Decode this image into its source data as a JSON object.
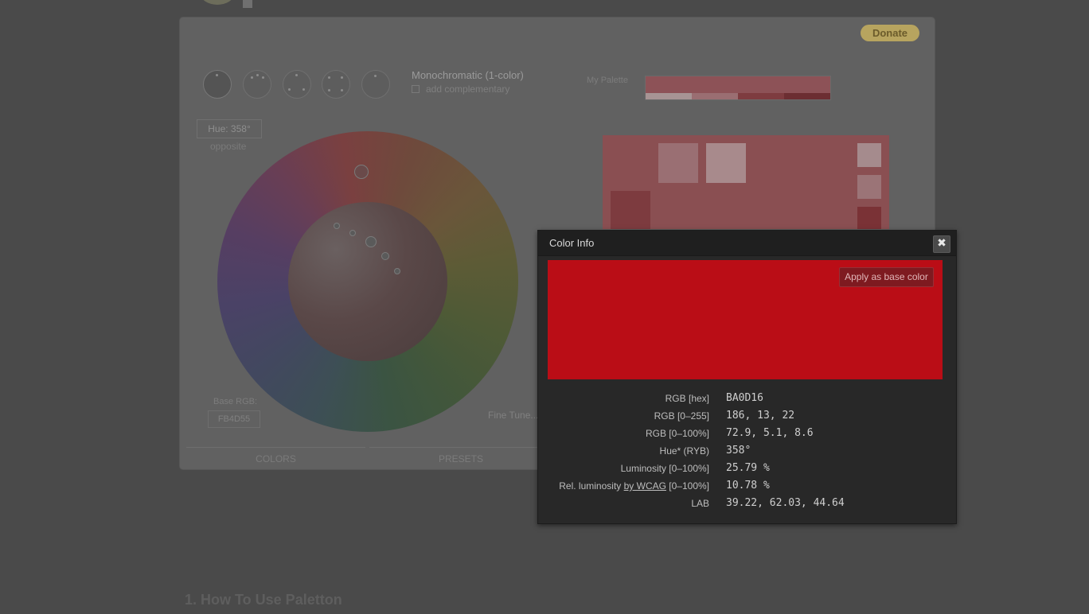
{
  "app": {
    "donate_label": "Donate",
    "scheme_title": "Monochromatic (1-color)",
    "scheme_option": "add complementary",
    "my_palette_label": "My Palette",
    "hue_label": "Hue: 358°",
    "opposite_label": "opposite",
    "base_rgb_label": "Base RGB:",
    "base_rgb_value": "FB4D55",
    "fine_tune_label": "Fine Tune...",
    "tabs": [
      {
        "label": "COLORS"
      },
      {
        "label": "PRESETS"
      }
    ],
    "section_heading": "1. How To Use Paletton"
  },
  "dialog": {
    "title": "Color Info",
    "close_glyph": "✖",
    "swatch_color": "#BA0D16",
    "apply_label": "Apply as base color",
    "rows": [
      {
        "label": "RGB [hex]",
        "value": "BA0D16"
      },
      {
        "label": "RGB [0–255]",
        "value": "186, 13, 22"
      },
      {
        "label": "RGB [0–100%]",
        "value": "72.9, 5.1, 8.6"
      },
      {
        "label": "Hue* (RYB)",
        "value": "358°"
      },
      {
        "label": "Luminosity [0–100%]",
        "value": "25.79 %"
      },
      {
        "label_prefix": "Rel. luminosity ",
        "label_link": "by WCAG",
        "label_suffix": " [0–100%]",
        "value": "10.78 %"
      },
      {
        "label": "LAB",
        "value": "39.22, 62.03, 44.64"
      }
    ]
  }
}
